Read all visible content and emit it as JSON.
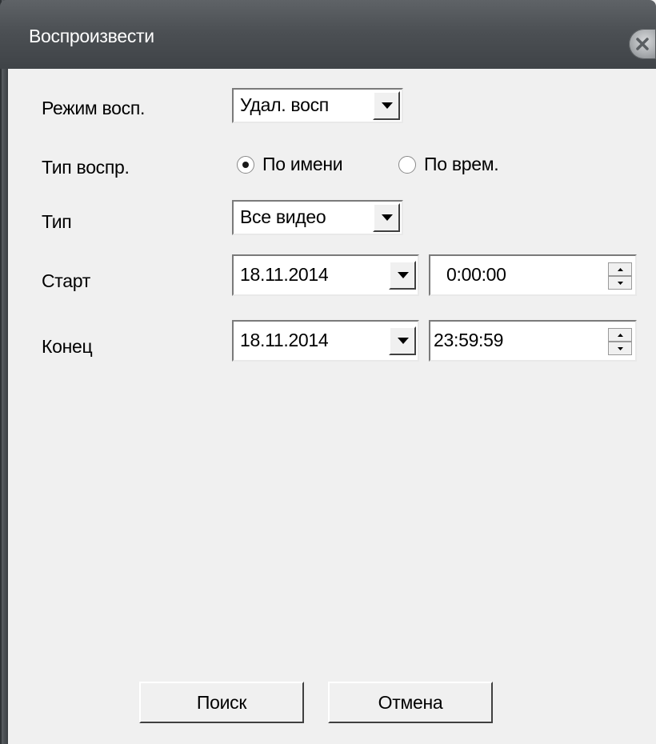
{
  "window": {
    "title": "Воспроизвести"
  },
  "form": {
    "mode": {
      "label": "Режим восп.",
      "value": "Удал. восп"
    },
    "playback_type": {
      "label": "Тип воспр.",
      "options": [
        {
          "label": "По имени",
          "selected": true
        },
        {
          "label": "По врем.",
          "selected": false
        }
      ]
    },
    "type": {
      "label": "Тип",
      "value": "Все видео"
    },
    "start": {
      "label": "Старт",
      "date": "18.11.2014",
      "time": "0:00:00"
    },
    "end": {
      "label": "Конец",
      "date": "18.11.2014",
      "time": "23:59:59"
    }
  },
  "buttons": {
    "search": "Поиск",
    "cancel": "Отмена"
  },
  "icons": {
    "close": "close-icon",
    "dropdown": "chevron-down-icon",
    "spin_up": "spin-up-icon",
    "spin_down": "spin-down-icon"
  },
  "colors": {
    "titlebar": "#4c5054",
    "face": "#f0f0f0"
  }
}
